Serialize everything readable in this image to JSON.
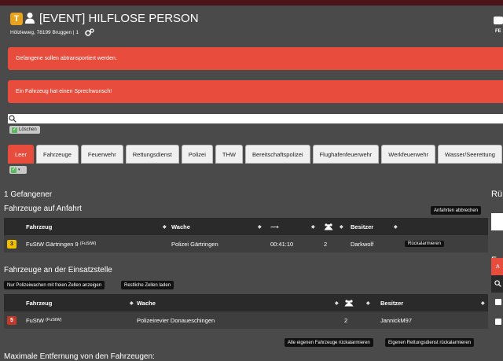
{
  "header": {
    "logo_text": "T",
    "title": "[EVENT] HILFLOSE PERSON",
    "address": "Hölzleweg, 78199 Bruggen | 1",
    "right_label": "FE"
  },
  "alerts": [
    {
      "text": "Gefangene sollen abtransportiert werden."
    },
    {
      "text": "Ein Fahrzeug hat einen Sprechwunsch!"
    }
  ],
  "search": {
    "value": "",
    "placeholder": ""
  },
  "delete_button": "Löschen",
  "tabs": [
    {
      "label": "Leer",
      "active": true
    },
    {
      "label": "Fahrzeuge"
    },
    {
      "label": "Feuerwehr"
    },
    {
      "label": "Rettungsdienst"
    },
    {
      "label": "Polizei"
    },
    {
      "label": "THW"
    },
    {
      "label": "Bereitschaftspolizei"
    },
    {
      "label": "Flughafenfeuerwehr"
    },
    {
      "label": "Werkfeuerwehr"
    },
    {
      "label": "Wasser/Seerettung"
    }
  ],
  "tab_dropdown_caret": "▾",
  "prisoners": "1 Gefangener",
  "approaching": {
    "heading": "Fahrzeuge auf Anfahrt",
    "cancel_button": "Anfahrten abbrechen",
    "columns": {
      "vehicle": "Fahrzeug",
      "station": "Wache",
      "time_icon": "⟿",
      "persons_icon": "persons-icon",
      "owner": "Besitzer"
    },
    "rows": [
      {
        "status": "3",
        "vehicle": "FuStW Gärtringen 9",
        "type": "(FuStW)",
        "station": "Polizei Gärtringen",
        "time": "00:41:10",
        "persons": "2",
        "owner": "Darkwolf",
        "action": "Rückalarmieren"
      }
    ]
  },
  "at_scene": {
    "heading": "Fahrzeuge an der Einsatzstelle",
    "buttons": [
      "Nur Polizeiwachen mit freien Zellen anzeigen",
      "Restliche Zellen laden"
    ],
    "columns": {
      "vehicle": "Fahrzeug",
      "station": "Wache",
      "persons_icon": "persons-icon",
      "owner": "Besitzer"
    },
    "rows": [
      {
        "status": "5",
        "vehicle": "FuStW",
        "type": "(FuStW)",
        "station": "Polizeirevier Donaueschingen",
        "persons": "2",
        "owner": "JannickM97"
      }
    ],
    "recall_all": "Alle eigenen Fahrzeuge rückalarmieren",
    "recall_ems": "Eigenen Rettungsdienst rückalarmieren"
  },
  "max_distance": "Maximale Entfernung von den Fahrzeugen:",
  "right_panel": {
    "ru": "Rü",
    "fre": "Fre",
    "red_tab": "A"
  },
  "colors": {
    "alert": "#e74c3c",
    "active_tab": "#e74c3c",
    "status3": "#f0c000",
    "status5": "#c0392b",
    "bg": "#4a4a4a"
  }
}
